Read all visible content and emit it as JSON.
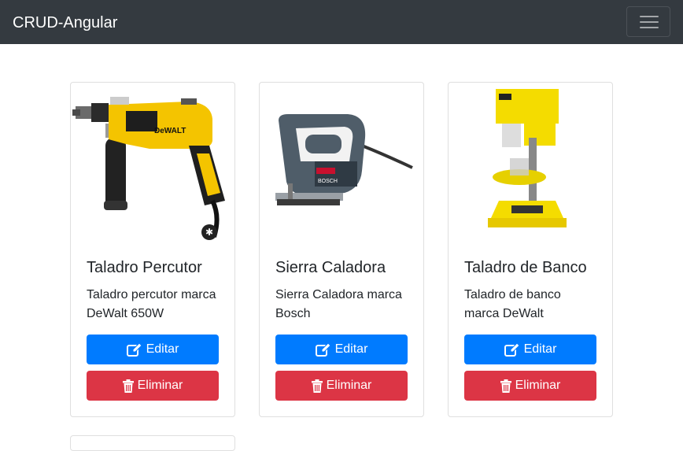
{
  "navbar": {
    "brand": "CRUD-Angular",
    "toggler_icon": "hamburger-menu-icon"
  },
  "products": [
    {
      "title": "Taladro Percutor",
      "description": "Taladro percutor marca DeWalt 650W",
      "image": "dewalt-hammer-drill-image",
      "edit_label": "Editar",
      "delete_label": "Eliminar"
    },
    {
      "title": "Sierra Caladora",
      "description": "Sierra Caladora marca Bosch",
      "image": "bosch-jigsaw-image",
      "edit_label": "Editar",
      "delete_label": "Eliminar"
    },
    {
      "title": "Taladro de Banco",
      "description": "Taladro de banco marca DeWalt",
      "image": "bench-drill-press-image",
      "edit_label": "Editar",
      "delete_label": "Eliminar"
    }
  ],
  "colors": {
    "navbar": "#343a40",
    "primary": "#007bff",
    "danger": "#dc3545"
  }
}
